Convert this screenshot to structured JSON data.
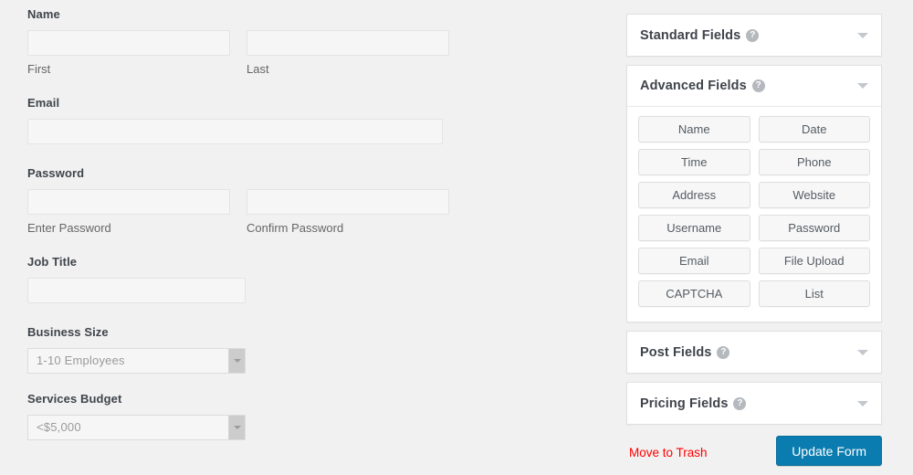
{
  "form_editor": {
    "fields": [
      {
        "type": "name",
        "label": "Name",
        "inputs": [
          {
            "value": "",
            "sub_label": "First"
          },
          {
            "value": "",
            "sub_label": "Last"
          }
        ]
      },
      {
        "type": "email",
        "label": "Email",
        "inputs": [
          {
            "value": "",
            "sub_label": ""
          }
        ]
      },
      {
        "type": "password",
        "label": "Password",
        "inputs": [
          {
            "value": "",
            "sub_label": "Enter Password"
          },
          {
            "value": "",
            "sub_label": "Confirm Password"
          }
        ]
      },
      {
        "type": "text",
        "label": "Job Title",
        "inputs": [
          {
            "value": "",
            "sub_label": ""
          }
        ]
      },
      {
        "type": "select",
        "label": "Business Size",
        "selected": "1-10 Employees"
      },
      {
        "type": "select",
        "label": "Services Budget",
        "selected": "<$5,000"
      }
    ]
  },
  "sidebar": {
    "panels": [
      {
        "id": "standard-fields",
        "title": "Standard Fields",
        "help_icon": "question-mark-icon",
        "toggle_icon": "chevron-down-icon",
        "expanded": false,
        "buttons": []
      },
      {
        "id": "advanced-fields",
        "title": "Advanced Fields",
        "help_icon": "question-mark-icon",
        "toggle_icon": "chevron-down-icon",
        "expanded": true,
        "buttons": [
          "Name",
          "Date",
          "Time",
          "Phone",
          "Address",
          "Website",
          "Username",
          "Password",
          "Email",
          "File Upload",
          "CAPTCHA",
          "List"
        ]
      },
      {
        "id": "post-fields",
        "title": "Post Fields",
        "help_icon": "question-mark-icon",
        "toggle_icon": "chevron-down-icon",
        "expanded": false,
        "buttons": []
      },
      {
        "id": "pricing-fields",
        "title": "Pricing Fields",
        "help_icon": "question-mark-icon",
        "toggle_icon": "chevron-down-icon",
        "expanded": false,
        "buttons": []
      }
    ],
    "actions": {
      "trash_label": "Move to Trash",
      "update_label": "Update Form"
    }
  },
  "colors": {
    "page_bg": "#f1f1f1",
    "panel_bg": "#ffffff",
    "label_text": "#3f444b",
    "sub_label_text": "#666666",
    "input_bg": "#f6f6f6",
    "input_border": "#e4e4e4",
    "select_text": "#9a9a9a",
    "primary_button": "#0b7cb0",
    "trash_link": "#ff0000",
    "help_icon_bg": "#b4b9be"
  },
  "icons": {
    "help": "?",
    "chevron_down": "▼"
  }
}
